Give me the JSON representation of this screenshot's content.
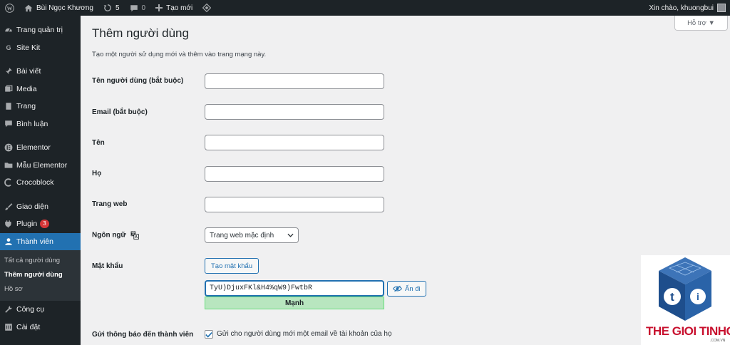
{
  "adminbar": {
    "site_name": "Bùi Ngọc Khương",
    "updates_count": "5",
    "comments_count": "0",
    "new_label": "Tạo mới",
    "greeting": "Xin chào, khuongbui"
  },
  "sidebar": {
    "items": [
      {
        "label": "Trang quản trị",
        "icon": "dashboard-icon"
      },
      {
        "label": "Site Kit",
        "icon": "google-g-icon"
      },
      {
        "label": "Bài viết",
        "icon": "pushpin-icon"
      },
      {
        "label": "Media",
        "icon": "media-icon"
      },
      {
        "label": "Trang",
        "icon": "page-icon"
      },
      {
        "label": "Bình luận",
        "icon": "comment-icon"
      },
      {
        "label": "Elementor",
        "icon": "elementor-icon"
      },
      {
        "label": "Mẫu Elementor",
        "icon": "folder-icon"
      },
      {
        "label": "Crocoblock",
        "icon": "crocoblock-icon"
      },
      {
        "label": "Giao diện",
        "icon": "brush-icon"
      },
      {
        "label": "Plugin",
        "icon": "plugin-icon",
        "badge": "3"
      },
      {
        "label": "Thành viên",
        "icon": "users-icon"
      },
      {
        "label": "Công cụ",
        "icon": "wrench-icon"
      },
      {
        "label": "Cài đặt",
        "icon": "settings-icon"
      }
    ],
    "submenu": [
      "Tất cả người dùng",
      "Thêm người dùng",
      "Hồ sơ"
    ]
  },
  "help_label": "Hỗ trợ ▼",
  "page": {
    "title": "Thêm người dùng",
    "description": "Tạo một người sử dụng mới và thêm vào trang mạng này."
  },
  "form": {
    "username_label": "Tên người dùng (bắt buộc)",
    "email_label": "Email (bắt buộc)",
    "first_name_label": "Tên",
    "last_name_label": "Họ",
    "website_label": "Trang web",
    "language_label": "Ngôn ngữ",
    "language_value": "Trang web mặc định",
    "password_label": "Mật khẩu",
    "generate_password_label": "Tạo mật khẩu",
    "password_value": "TyU)DjuxFKl&H4%qW9)FwtbR",
    "strength_label": "Mạnh",
    "hide_label": "Ẩn đi",
    "notify_label": "Gửi thông báo đến thành viên",
    "notify_text": "Gửi cho người dùng mới một email về tài khoản của họ"
  },
  "watermark": {
    "brand": "THE GIOI TINHOC",
    "domain": ".COM.VN"
  },
  "colors": {
    "accent": "#2271b1",
    "adminbar": "#1d2327",
    "strength_bg": "#b8e6bf",
    "badge": "#d63638"
  }
}
